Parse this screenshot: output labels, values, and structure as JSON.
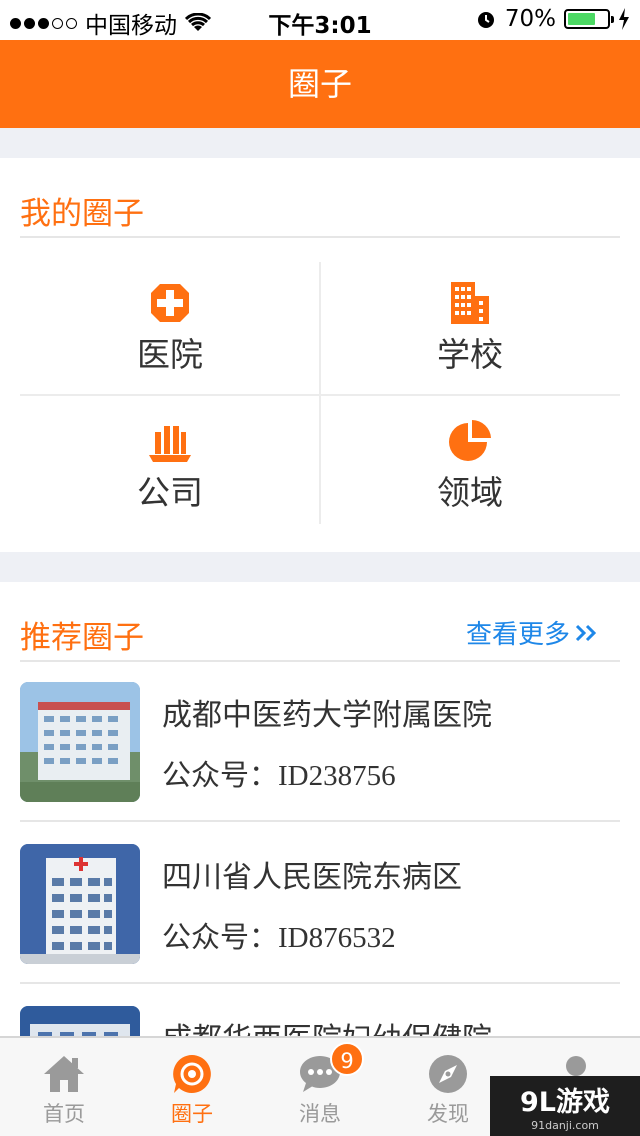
{
  "status_bar": {
    "carrier": "中国移动",
    "time": "下午3:01",
    "battery": "70%",
    "battery_level": 0.7,
    "signal_bars_filled": 3,
    "signal_bars_total": 5
  },
  "header": {
    "title": "圈子"
  },
  "my_circles": {
    "title": "我的圈子",
    "items": [
      {
        "label": "医院",
        "icon": "hospital-icon"
      },
      {
        "label": "学校",
        "icon": "building-icon"
      },
      {
        "label": "公司",
        "icon": "company-icon"
      },
      {
        "label": "领域",
        "icon": "pie-chart-icon"
      }
    ]
  },
  "recommended": {
    "title": "推荐圈子",
    "more_label": "查看更多",
    "more_icon": "double-chevron-right-icon",
    "items": [
      {
        "name": "成都中医药大学附属医院",
        "id_text": "公众号：ID238756"
      },
      {
        "name": "四川省人民医院东病区",
        "id_text": "公众号：ID876532"
      },
      {
        "name": "成都华西医院妇幼保健院",
        "id_text": ""
      }
    ]
  },
  "tabbar": {
    "tabs": [
      {
        "label": "首页",
        "icon": "home-icon"
      },
      {
        "label": "圈子",
        "icon": "circle-icon"
      },
      {
        "label": "消息",
        "icon": "chat-icon",
        "badge": "9"
      },
      {
        "label": "发现",
        "icon": "compass-icon"
      },
      {
        "label": "",
        "icon": "user-icon"
      }
    ]
  },
  "watermark": {
    "main": "9L游戏",
    "sub": "91danji.com"
  },
  "colors": {
    "accent": "#ff7011",
    "link": "#1e87e8",
    "battery": "#4cd964"
  }
}
